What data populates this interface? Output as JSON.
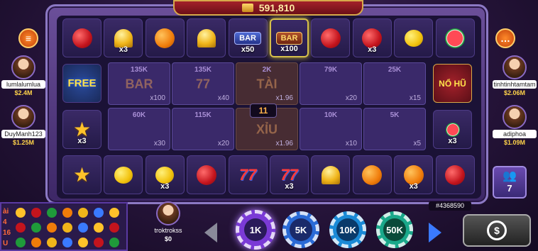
{
  "jackpot": {
    "value": "591,810"
  },
  "top_row": [
    {
      "symbol": "apple",
      "mult": ""
    },
    {
      "symbol": "bell",
      "mult": "x3"
    },
    {
      "symbol": "orange",
      "mult": ""
    },
    {
      "symbol": "bell",
      "mult": ""
    },
    {
      "symbol": "bar",
      "mult": "x50",
      "label": "BAR"
    },
    {
      "symbol": "bar-gold",
      "mult": "x100",
      "label": "BAR"
    },
    {
      "symbol": "apple",
      "mult": ""
    },
    {
      "symbol": "apple",
      "mult": "x3"
    },
    {
      "symbol": "lemon",
      "mult": ""
    },
    {
      "symbol": "melon",
      "mult": ""
    }
  ],
  "bottom_row": [
    {
      "symbol": "star",
      "mult": ""
    },
    {
      "symbol": "lemon",
      "mult": ""
    },
    {
      "symbol": "lemon",
      "mult": "x3"
    },
    {
      "symbol": "apple",
      "mult": ""
    },
    {
      "symbol": "seven",
      "mult": "",
      "label": "77"
    },
    {
      "symbol": "seven",
      "mult": "x3",
      "label": "77"
    },
    {
      "symbol": "bell",
      "mult": ""
    },
    {
      "symbol": "orange",
      "mult": ""
    },
    {
      "symbol": "orange",
      "mult": "x3"
    },
    {
      "symbol": "apple",
      "mult": ""
    }
  ],
  "side_left": [
    {
      "label": "FREE"
    },
    {
      "symbol": "star",
      "mult": "x3"
    }
  ],
  "side_right": [
    {
      "label": "NỔ HŨ"
    },
    {
      "symbol": "melon",
      "mult": "x3"
    }
  ],
  "bets_row1": [
    {
      "amount": "135K",
      "mult": "x100",
      "label": "BAR"
    },
    {
      "amount": "135K",
      "mult": "x40",
      "label": "77"
    },
    {
      "amount": "2K",
      "mult": "x1.96",
      "label": "TÀI"
    },
    {
      "amount": "79K",
      "mult": "x20"
    },
    {
      "amount": "25K",
      "mult": "x15"
    }
  ],
  "bets_row2": [
    {
      "amount": "60K",
      "mult": "x30"
    },
    {
      "amount": "115K",
      "mult": "x20"
    },
    {
      "amount": "2K",
      "mult": "x1.96",
      "label": "XỈU"
    },
    {
      "amount": "10K",
      "mult": "x10"
    },
    {
      "amount": "5K",
      "mult": "x5"
    }
  ],
  "timer": "11",
  "players_left": [
    {
      "name": "lumlalumlua",
      "money": "$2.4M"
    },
    {
      "name": "DuyManh123",
      "money": "$1.25M"
    }
  ],
  "players_right": [
    {
      "name": "tinhtinhtamtam",
      "money": "$2.06M"
    },
    {
      "name": "adiphoa",
      "money": "$1.09M"
    }
  ],
  "self_player": {
    "name": "troktrokss",
    "money": "$0"
  },
  "session_id": "#4368590",
  "online_count": "7",
  "chips": [
    "1K",
    "5K",
    "10K",
    "50K"
  ],
  "colors": {
    "accent": "#ffd34a",
    "frame": "#8c79c4",
    "chip_1k": "#7a3ad6",
    "chip_5k": "#2a6ad6",
    "chip_10k": "#1a8ad6",
    "chip_50k": "#1aa88a"
  },
  "icons": {
    "menu": "menu-icon",
    "chat": "chat-icon",
    "group": "group-icon",
    "spin": "auto-spin-icon",
    "left_arrow": "arrow-left-icon",
    "right_arrow": "arrow-right-icon"
  },
  "history_left": {
    "labels": [
      "ài",
      "4",
      "16",
      "U"
    ]
  }
}
